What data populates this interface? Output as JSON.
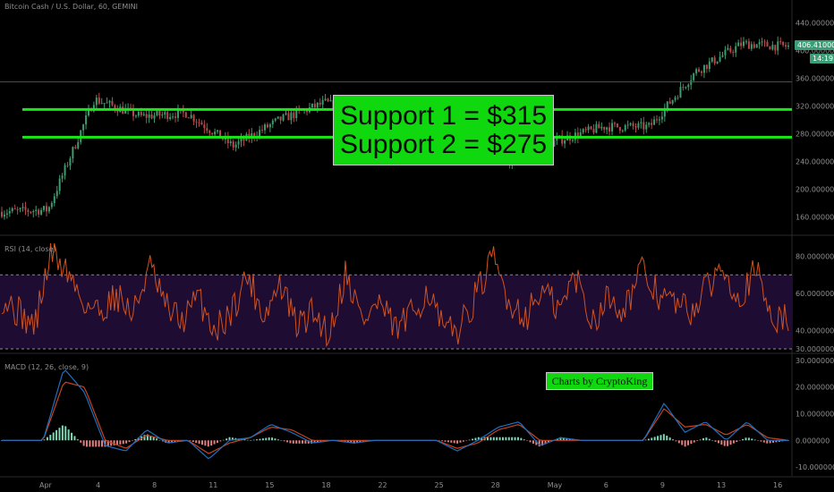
{
  "chart_data": [
    {
      "type": "line",
      "title": "Bitcoin Cash / U.S. Dollar, 60, GEMINI",
      "ylim": [
        150,
        450
      ],
      "yticks": [
        "440.000000",
        "400.000000",
        "360.000000",
        "320.000000",
        "280.000000",
        "240.000000",
        "200.000000",
        "160.000000"
      ],
      "last_price": "406.410000",
      "countdown": "14:19",
      "x": [
        "Apr",
        "4",
        "8",
        "11",
        "15",
        "18",
        "22",
        "25",
        "28",
        "May",
        "6",
        "9",
        "13",
        "16"
      ],
      "values": [
        167,
        170,
        330,
        305,
        310,
        262,
        300,
        325,
        300,
        285,
        300,
        240,
        270,
        290,
        290,
        370,
        410,
        406
      ],
      "resistance": 355,
      "supports": [
        315,
        275
      ],
      "annotation": [
        "Support 1 = $315",
        "Support 2 = $275"
      ]
    },
    {
      "type": "line",
      "title": "RSI (14, close)",
      "ylim": [
        30,
        88
      ],
      "yticks": [
        "80.000000",
        "60.000000",
        "40.000000",
        "30.000000"
      ],
      "bands": [
        70,
        30
      ],
      "values": [
        58,
        50,
        42,
        82,
        72,
        55,
        50,
        60,
        48,
        75,
        52,
        45,
        58,
        40,
        50,
        70,
        48,
        65,
        42,
        50,
        38,
        72,
        45,
        55,
        40,
        48,
        62,
        38,
        42,
        60,
        78,
        55,
        48,
        62,
        50,
        70,
        45,
        58,
        52,
        72,
        60,
        55,
        50,
        62,
        76,
        58,
        72,
        48,
        45
      ]
    },
    {
      "type": "line",
      "title": "MACD (12, 26, close, 9)",
      "ylim": [
        -12,
        31
      ],
      "yticks": [
        "30.000000",
        "20.000000",
        "10.000000",
        "0.000000",
        "-10.000000"
      ],
      "series": [
        {
          "name": "MACD",
          "values": [
            0,
            0,
            0,
            27,
            18,
            -2,
            -4,
            4,
            -1,
            0,
            -7,
            0,
            1,
            6,
            3,
            -1,
            0,
            -1,
            0,
            0,
            0,
            0,
            -4,
            0,
            5,
            7,
            -2,
            1,
            0,
            0,
            0,
            0,
            14,
            3,
            7,
            0,
            7,
            0,
            0
          ]
        },
        {
          "name": "Signal",
          "values": [
            0,
            0,
            0,
            22,
            20,
            0,
            -3,
            2,
            0,
            0,
            -5,
            -1,
            1,
            5,
            4,
            0,
            0,
            0,
            0,
            0,
            0,
            0,
            -3,
            -1,
            4,
            6,
            0,
            0,
            0,
            0,
            0,
            0,
            12,
            5,
            6,
            2,
            6,
            1,
            0
          ]
        }
      ],
      "annotation": "Charts by CryptoKing"
    }
  ],
  "colors": {
    "background": "#000000",
    "support": "#17e816",
    "candle_up": "#3f9a6e",
    "candle_down": "#b54a4a",
    "rsi": "#d0531f",
    "rsi_band_fill": "#1f0c33",
    "macd": "#1e6fc0",
    "signal": "#c7431f",
    "hist_up": "#7dd6b5",
    "hist_down": "#e08080",
    "price_badge": "#3b9e76"
  }
}
